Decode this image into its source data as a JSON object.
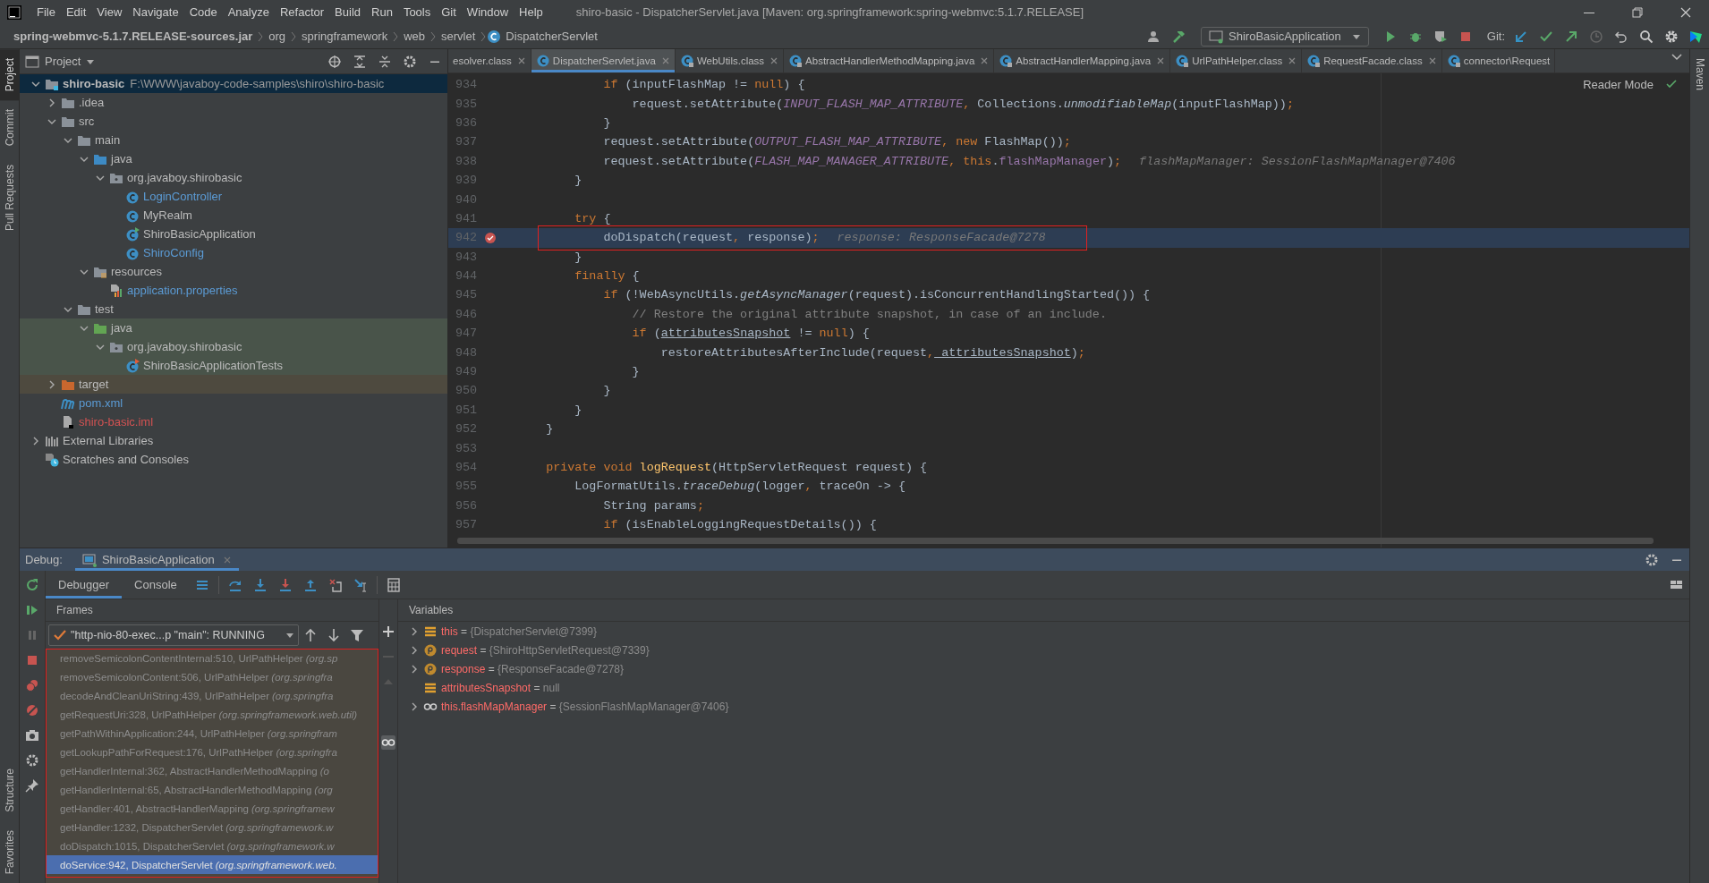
{
  "window": {
    "title": "shiro-basic - DispatcherServlet.java [Maven: org.springframework:spring-webmvc:5.1.7.RELEASE]"
  },
  "menu": [
    "File",
    "Edit",
    "View",
    "Navigate",
    "Code",
    "Analyze",
    "Refactor",
    "Build",
    "Run",
    "Tools",
    "Git",
    "Window",
    "Help"
  ],
  "breadcrumbs": [
    "spring-webmvc-5.1.7.RELEASE-sources.jar",
    "org",
    "springframework",
    "web",
    "servlet",
    "DispatcherServlet"
  ],
  "toolbar": {
    "run_config": "ShiroBasicApplication",
    "git_label": "Git:"
  },
  "stripe_left_top": [
    {
      "label": "Project",
      "selected": true
    },
    {
      "label": "Commit",
      "selected": false
    },
    {
      "label": "Pull Requests",
      "selected": false
    }
  ],
  "stripe_left_bottom": [
    {
      "label": "Structure",
      "selected": false
    },
    {
      "label": "Favorites",
      "selected": false
    }
  ],
  "stripe_right": [
    {
      "label": "Maven",
      "selected": false
    }
  ],
  "project": {
    "title": "Project",
    "tree": [
      {
        "label": "shiro-basic",
        "path": "F:\\WWW\\javaboy-code-samples\\shiro\\shiro-basic",
        "kind": "module",
        "expanded": true,
        "selected": true,
        "color": "#bbbbbb",
        "children": [
          {
            "label": ".idea",
            "kind": "folder",
            "expanded": false,
            "selected": false,
            "color": "#bbbbbb"
          },
          {
            "label": "src",
            "kind": "folder",
            "expanded": true,
            "selected": false,
            "color": "#bbbbbb",
            "children": [
              {
                "label": "main",
                "kind": "folder",
                "expanded": true,
                "selected": false,
                "color": "#bbbbbb",
                "children": [
                  {
                    "label": "java",
                    "kind": "source",
                    "expanded": true,
                    "selected": false,
                    "color": "#bbbbbb",
                    "children": [
                      {
                        "label": "org.javaboy.shirobasic",
                        "kind": "package",
                        "expanded": true,
                        "selected": false,
                        "color": "#bbbbbb",
                        "children": [
                          {
                            "label": "LoginController",
                            "kind": "class",
                            "selected": false,
                            "color": "#5b9bd5"
                          },
                          {
                            "label": "MyRealm",
                            "kind": "class",
                            "selected": false,
                            "color": "#bbbbbb"
                          },
                          {
                            "label": "ShiroBasicApplication",
                            "kind": "runnable",
                            "selected": false,
                            "color": "#bbbbbb"
                          },
                          {
                            "label": "ShiroConfig",
                            "kind": "class",
                            "selected": false,
                            "color": "#5b9bd5"
                          }
                        ]
                      }
                    ]
                  },
                  {
                    "label": "resources",
                    "kind": "resources",
                    "expanded": true,
                    "selected": false,
                    "color": "#bbbbbb",
                    "children": [
                      {
                        "label": "application.properties",
                        "kind": "properties",
                        "selected": false,
                        "color": "#5b9bd5"
                      }
                    ]
                  }
                ]
              },
              {
                "label": "test",
                "kind": "folder",
                "expanded": true,
                "selected": false,
                "color": "#bbbbbb",
                "children": [
                  {
                    "label": "java",
                    "kind": "tests",
                    "expanded": true,
                    "selected": false,
                    "color": "#bbbbbb",
                    "test_scope": true,
                    "children": [
                      {
                        "label": "org.javaboy.shirobasic",
                        "kind": "package",
                        "expanded": true,
                        "selected": false,
                        "color": "#bbbbbb",
                        "test_scope": true,
                        "children": [
                          {
                            "label": "ShiroBasicApplicationTests",
                            "kind": "testcase",
                            "selected": false,
                            "color": "#bbbbbb",
                            "test_scope": true
                          }
                        ]
                      }
                    ]
                  }
                ]
              }
            ]
          },
          {
            "label": "target",
            "kind": "excluded",
            "expanded": false,
            "selected": false,
            "color": "#bbbbbb",
            "excluded": true
          },
          {
            "label": "pom.xml",
            "kind": "maven",
            "selected": false,
            "color": "#5b9bd5"
          },
          {
            "label": "shiro-basic.iml",
            "kind": "iml",
            "selected": false,
            "color": "#d25252"
          }
        ]
      },
      {
        "label": "External Libraries",
        "kind": "libraries",
        "expanded": false,
        "selected": false,
        "color": "#bbbbbb"
      },
      {
        "label": "Scratches and Consoles",
        "kind": "scratches",
        "selected": false,
        "color": "#bbbbbb"
      }
    ]
  },
  "editor": {
    "tabs": [
      {
        "label": "esolver.class",
        "kind": "plain",
        "selected": false
      },
      {
        "label": "DispatcherServlet.java",
        "kind": "class",
        "selected": true
      },
      {
        "label": "WebUtils.class",
        "kind": "library",
        "selected": false
      },
      {
        "label": "AbstractHandlerMethodMapping.java",
        "kind": "library",
        "selected": false
      },
      {
        "label": "AbstractHandlerMapping.java",
        "kind": "library",
        "selected": false
      },
      {
        "label": "UrlPathHelper.class",
        "kind": "library",
        "selected": false
      },
      {
        "label": "RequestFacade.class",
        "kind": "library",
        "selected": false
      },
      {
        "label": "connector\\Request",
        "kind": "library",
        "selected": false
      }
    ],
    "reader_mode": "Reader Mode",
    "lines": [
      {
        "n": "934",
        "current": false,
        "breakpoint": false,
        "annotated": false,
        "tokens": [
          {
            "text": "            if",
            "kind": "kw"
          },
          {
            "text": " (inputFlashMap != ",
            "kind": "plain"
          },
          {
            "text": "null",
            "kind": "kw"
          },
          {
            "text": ") {",
            "kind": "plain"
          }
        ]
      },
      {
        "n": "935",
        "current": false,
        "breakpoint": false,
        "annotated": false,
        "tokens": [
          {
            "text": "                request.setAttribute(",
            "kind": "plain"
          },
          {
            "text": "INPUT_FLASH_MAP_ATTRIBUTE",
            "kind": "const"
          },
          {
            "text": ",",
            "kind": "kw"
          },
          {
            "text": " Collections.",
            "kind": "plain"
          },
          {
            "text": "unmodifiableMap",
            "kind": "static"
          },
          {
            "text": "(inputFlashMap))",
            "kind": "plain"
          },
          {
            "text": ";",
            "kind": "kw"
          }
        ]
      },
      {
        "n": "936",
        "current": false,
        "breakpoint": false,
        "annotated": false,
        "tokens": [
          {
            "text": "            }",
            "kind": "plain"
          }
        ]
      },
      {
        "n": "937",
        "current": false,
        "breakpoint": false,
        "annotated": false,
        "tokens": [
          {
            "text": "            request.setAttribute(",
            "kind": "plain"
          },
          {
            "text": "OUTPUT_FLASH_MAP_ATTRIBUTE",
            "kind": "const"
          },
          {
            "text": ", new",
            "kind": "kw"
          },
          {
            "text": " FlashMap())",
            "kind": "plain"
          },
          {
            "text": ";",
            "kind": "kw"
          }
        ]
      },
      {
        "n": "938",
        "current": false,
        "breakpoint": false,
        "annotated": false,
        "tokens": [
          {
            "text": "            request.setAttribute(",
            "kind": "plain"
          },
          {
            "text": "FLASH_MAP_MANAGER_ATTRIBUTE",
            "kind": "const"
          },
          {
            "text": ", this",
            "kind": "kw"
          },
          {
            "text": ".",
            "kind": "plain"
          },
          {
            "text": "flashMapManager",
            "kind": "field"
          },
          {
            "text": ")",
            "kind": "plain"
          },
          {
            "text": ";",
            "kind": "kw"
          }
        ],
        "hint": "flashMapManager: SessionFlashMapManager@7406"
      },
      {
        "n": "939",
        "current": false,
        "breakpoint": false,
        "annotated": false,
        "tokens": [
          {
            "text": "        }",
            "kind": "plain"
          }
        ]
      },
      {
        "n": "940",
        "current": false,
        "breakpoint": false,
        "annotated": false
      },
      {
        "n": "941",
        "current": false,
        "breakpoint": false,
        "annotated": false,
        "tokens": [
          {
            "text": "        try",
            "kind": "kw"
          },
          {
            "text": " {",
            "kind": "plain"
          }
        ]
      },
      {
        "n": "942",
        "current": true,
        "breakpoint": true,
        "annotated": true,
        "tokens": [
          {
            "text": "            doDispatch(request",
            "kind": "plain"
          },
          {
            "text": ",",
            "kind": "kw"
          },
          {
            "text": " response)",
            "kind": "plain"
          },
          {
            "text": ";",
            "kind": "kw"
          }
        ],
        "hint": "response: ResponseFacade@7278"
      },
      {
        "n": "943",
        "current": false,
        "breakpoint": false,
        "annotated": false,
        "tokens": [
          {
            "text": "        }",
            "kind": "plain"
          }
        ]
      },
      {
        "n": "944",
        "current": false,
        "breakpoint": false,
        "annotated": false,
        "tokens": [
          {
            "text": "        finally",
            "kind": "kw"
          },
          {
            "text": " {",
            "kind": "plain"
          }
        ]
      },
      {
        "n": "945",
        "current": false,
        "breakpoint": false,
        "annotated": false,
        "tokens": [
          {
            "text": "            if",
            "kind": "kw"
          },
          {
            "text": " (!WebAsyncUtils.",
            "kind": "plain"
          },
          {
            "text": "getAsyncManager",
            "kind": "static"
          },
          {
            "text": "(request).isConcurrentHandlingStarted()) {",
            "kind": "plain"
          }
        ]
      },
      {
        "n": "946",
        "current": false,
        "breakpoint": false,
        "annotated": false,
        "tokens": [
          {
            "text": "                // Restore the original attribute snapshot, in case of an include.",
            "kind": "comment"
          }
        ]
      },
      {
        "n": "947",
        "current": false,
        "breakpoint": false,
        "annotated": false,
        "tokens": [
          {
            "text": "                if",
            "kind": "kw"
          },
          {
            "text": " (",
            "kind": "plain"
          },
          {
            "text": "attributesSnapshot",
            "kind": "var"
          },
          {
            "text": " != ",
            "kind": "plain"
          },
          {
            "text": "null",
            "kind": "kw"
          },
          {
            "text": ") {",
            "kind": "plain"
          }
        ]
      },
      {
        "n": "948",
        "current": false,
        "breakpoint": false,
        "annotated": false,
        "tokens": [
          {
            "text": "                    restoreAttributesAfterInclude(request",
            "kind": "plain"
          },
          {
            "text": ",",
            "kind": "kw"
          },
          {
            "text": " attributesSnapshot",
            "kind": "var"
          },
          {
            "text": ")",
            "kind": "plain"
          },
          {
            "text": ";",
            "kind": "kw"
          }
        ]
      },
      {
        "n": "949",
        "current": false,
        "breakpoint": false,
        "annotated": false,
        "tokens": [
          {
            "text": "                }",
            "kind": "plain"
          }
        ]
      },
      {
        "n": "950",
        "current": false,
        "breakpoint": false,
        "annotated": false,
        "tokens": [
          {
            "text": "            }",
            "kind": "plain"
          }
        ]
      },
      {
        "n": "951",
        "current": false,
        "breakpoint": false,
        "annotated": false,
        "tokens": [
          {
            "text": "        }",
            "kind": "plain"
          }
        ]
      },
      {
        "n": "952",
        "current": false,
        "breakpoint": false,
        "annotated": false,
        "tokens": [
          {
            "text": "    }",
            "kind": "plain"
          }
        ]
      },
      {
        "n": "953",
        "current": false,
        "breakpoint": false,
        "annotated": false
      },
      {
        "n": "954",
        "current": false,
        "breakpoint": false,
        "annotated": false,
        "tokens": [
          {
            "text": "    private void ",
            "kind": "kw"
          },
          {
            "text": "logRequest",
            "kind": "fn"
          },
          {
            "text": "(HttpServletRequest request) {",
            "kind": "plain"
          }
        ]
      },
      {
        "n": "955",
        "current": false,
        "breakpoint": false,
        "annotated": false,
        "tokens": [
          {
            "text": "        LogFormatUtils.",
            "kind": "plain"
          },
          {
            "text": "traceDebug",
            "kind": "static"
          },
          {
            "text": "(logger",
            "kind": "plain"
          },
          {
            "text": ",",
            "kind": "kw"
          },
          {
            "text": " traceOn -> {",
            "kind": "plain"
          }
        ]
      },
      {
        "n": "956",
        "current": false,
        "breakpoint": false,
        "annotated": false,
        "tokens": [
          {
            "text": "            String params",
            "kind": "plain"
          },
          {
            "text": ";",
            "kind": "kw"
          }
        ]
      },
      {
        "n": "957",
        "current": false,
        "breakpoint": false,
        "annotated": false,
        "tokens": [
          {
            "text": "            if",
            "kind": "kw"
          },
          {
            "text": " (isEnableLoggingRequestDetails()) {",
            "kind": "plain"
          }
        ]
      }
    ]
  },
  "debug": {
    "label": "Debug:",
    "session": "ShiroBasicApplication",
    "tabs": [
      {
        "label": "Debugger",
        "selected": true
      },
      {
        "label": "Console",
        "selected": false
      }
    ],
    "frames_title": "Frames",
    "thread": "\"http-nio-80-exec...p \"main\": RUNNING",
    "annotated": true,
    "frames": [
      {
        "method": "removeSemicolonContentInternal:510, UrlPathHelper",
        "package": "(org.sp",
        "selected": false
      },
      {
        "method": "removeSemicolonContent:506, UrlPathHelper",
        "package": "(org.springfra",
        "selected": false
      },
      {
        "method": "decodeAndCleanUriString:439, UrlPathHelper",
        "package": "(org.springfra",
        "selected": false
      },
      {
        "method": "getRequestUri:328, UrlPathHelper",
        "package": "(org.springframework.web.util)",
        "selected": false
      },
      {
        "method": "getPathWithinApplication:244, UrlPathHelper",
        "package": "(org.springfram",
        "selected": false
      },
      {
        "method": "getLookupPathForRequest:176, UrlPathHelper",
        "package": "(org.springfra",
        "selected": false
      },
      {
        "method": "getHandlerInternal:362, AbstractHandlerMethodMapping",
        "package": "(o",
        "selected": false
      },
      {
        "method": "getHandlerInternal:65, AbstractHandlerMethodMapping",
        "package": "(org",
        "selected": false
      },
      {
        "method": "getHandler:401, AbstractHandlerMapping",
        "package": "(org.springframew",
        "selected": false
      },
      {
        "method": "getHandler:1232, DispatcherServlet",
        "package": "(org.springframework.w",
        "selected": false
      },
      {
        "method": "doDispatch:1015, DispatcherServlet",
        "package": "(org.springframework.w",
        "selected": false
      },
      {
        "method": "doService:942, DispatcherServlet",
        "package": "(org.springframework.web.",
        "selected": true
      }
    ],
    "variables_title": "Variables",
    "variables": [
      {
        "name": "this",
        "op": "=",
        "value": "{DispatcherServlet@7399}",
        "kind": "field",
        "expandable": true
      },
      {
        "name": "request",
        "op": "=",
        "value": "{ShiroHttpServletRequest@7339}",
        "kind": "param",
        "expandable": true
      },
      {
        "name": "response",
        "op": "=",
        "value": "{ResponseFacade@7278}",
        "kind": "param",
        "expandable": true
      },
      {
        "name": "attributesSnapshot",
        "op": "=",
        "value": "null",
        "kind": "field",
        "expandable": false
      },
      {
        "name": "this.flashMapManager",
        "op": "=",
        "value": "{SessionFlashMapManager@7406}",
        "kind": "watch",
        "expandable": true
      }
    ]
  }
}
